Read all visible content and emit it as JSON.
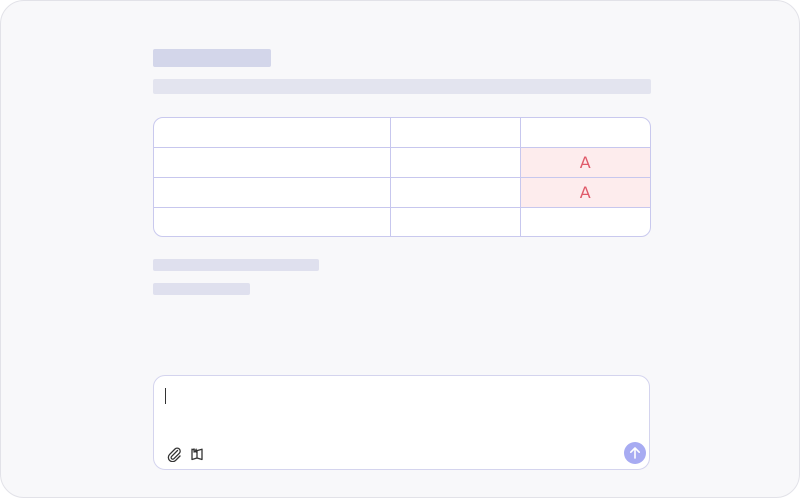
{
  "table": {
    "rows": [
      [
        "",
        "",
        ""
      ],
      [
        "",
        "",
        "A"
      ],
      [
        "",
        "",
        "A"
      ],
      [
        "",
        "",
        ""
      ]
    ]
  },
  "composer": {
    "value": "",
    "placeholder": ""
  },
  "icons": {
    "attach": "paperclip-icon",
    "library": "book-icon",
    "send": "arrow-up-icon"
  },
  "colors": {
    "flagged_cell_bg": "#fdeced",
    "flagged_cell_text": "#e05a6a",
    "send_button": "#a7abf2",
    "grid_border": "#c7c7ee"
  }
}
